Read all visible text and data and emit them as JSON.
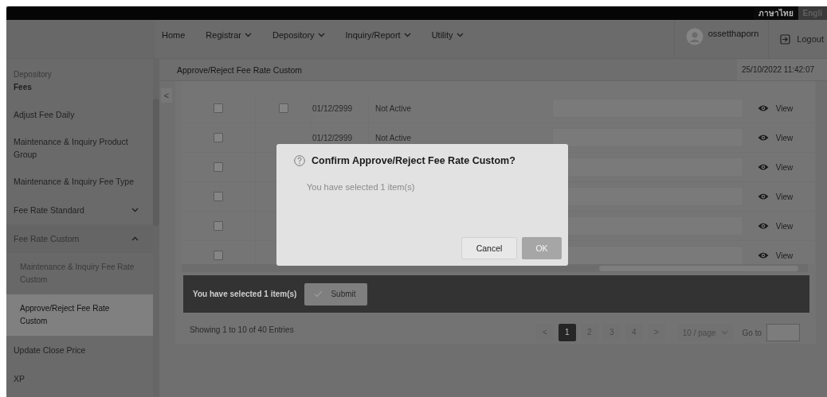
{
  "top_bar": {
    "languages": [
      {
        "label": "ภาษาไทย",
        "selected": true
      },
      {
        "label": "Engli",
        "selected": false
      }
    ]
  },
  "nav": {
    "items": [
      {
        "label": "Home",
        "dropdown": false
      },
      {
        "label": "Registrar",
        "dropdown": true
      },
      {
        "label": "Depository",
        "dropdown": true
      },
      {
        "label": "Inquiry/Report",
        "dropdown": true
      },
      {
        "label": "Utility",
        "dropdown": true
      }
    ],
    "user": "ossetthaporn",
    "logout": "Logout"
  },
  "sidebar": {
    "section": "Depository",
    "group": "Fees",
    "collapse": "<",
    "items": [
      {
        "label": "Adjust Fee Daily",
        "kind": "link",
        "selected": false
      },
      {
        "label": "Maintenance & Inquiry Product Group",
        "kind": "link",
        "selected": false
      },
      {
        "label": "Maintenance & Inquiry Fee Type",
        "kind": "link",
        "selected": false
      },
      {
        "label": "Fee Rate Standard",
        "kind": "group",
        "expanded": false,
        "selected": false
      },
      {
        "label": "Fee Rate Custom",
        "kind": "group",
        "expanded": true,
        "selected": false,
        "children": [
          {
            "label": "Maintenance & Inquiry Fee Rate Custom",
            "selected": false
          },
          {
            "label": "Approve/Reject Fee Rate Custom",
            "selected": true
          }
        ]
      },
      {
        "label": "Update Close Price",
        "kind": "link",
        "selected": false
      },
      {
        "label": "XP",
        "kind": "link",
        "selected": false
      }
    ]
  },
  "page_title": "Approve/Reject Fee Rate Custom",
  "datetime": "25/10/2022 11:42:07",
  "table": {
    "rows": [
      {
        "checked": false,
        "checked_2": false,
        "date": "01/12/2999",
        "status": "Not Active",
        "action": "View"
      },
      {
        "checked": false,
        "date": "01/12/2999",
        "status": "Not Active",
        "action": "View"
      },
      {
        "checked": false,
        "action": "View"
      },
      {
        "checked": false,
        "action": "View"
      },
      {
        "checked": false,
        "action": "View"
      },
      {
        "checked": false,
        "action": "View"
      }
    ]
  },
  "selection_bar": {
    "text": "You have selected 1 item(s)",
    "button": "Submit"
  },
  "footer": {
    "entries": "Showing 1 to 10 of 40 Entries",
    "prev": "<",
    "next": ">",
    "pages": [
      {
        "label": "1",
        "selected": true
      },
      {
        "label": "2",
        "selected": false
      },
      {
        "label": "3",
        "selected": false
      },
      {
        "label": "4",
        "selected": false
      }
    ],
    "page_size": "10 / page",
    "goto": "Go to"
  },
  "dialog": {
    "title": "Confirm Approve/Reject Fee Rate Custom?",
    "message": "You have selected 1 item(s)",
    "buttons": [
      {
        "label": "Cancel",
        "kind": "default",
        "disabled": false
      },
      {
        "label": "OK",
        "kind": "primary",
        "disabled": true
      }
    ]
  }
}
